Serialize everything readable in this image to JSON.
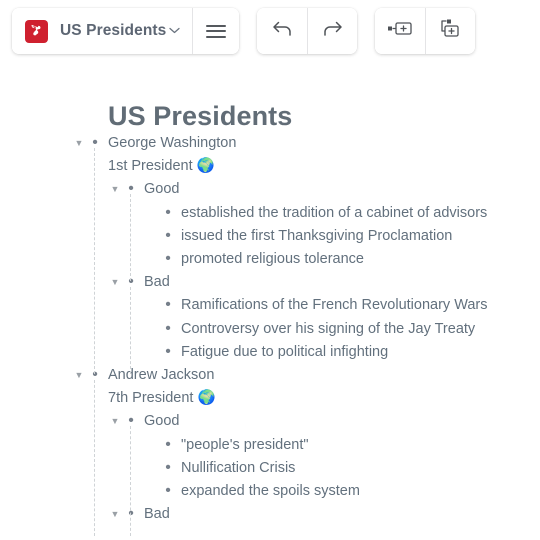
{
  "toolbar": {
    "logo_icon": "dynalist-logo-icon",
    "document_title": "US Presidents",
    "chevron": "⌄",
    "chevron_icon": "chevron-down-icon",
    "menu_icon": "hamburger-menu-icon",
    "undo_icon": "undo-arrow-icon",
    "redo_icon": "redo-arrow-icon",
    "insert_item_icon": "insert-item-icon",
    "insert_child_icon": "insert-child-item-icon"
  },
  "page": {
    "title": "US Presidents"
  },
  "outline": {
    "collapse_triangle": "▼",
    "bullet": "•",
    "rows": [
      {
        "depth": 0,
        "type": "item",
        "text": "George Washington",
        "has_triangle": true
      },
      {
        "depth": 0,
        "type": "note",
        "text": "1st President 🌍",
        "has_triangle": false
      },
      {
        "depth": 1,
        "type": "item",
        "text": "Good",
        "has_triangle": true
      },
      {
        "depth": 2,
        "type": "item",
        "text": "established the tradition of a cabinet of advisors",
        "has_triangle": false
      },
      {
        "depth": 2,
        "type": "item",
        "text": "issued the first Thanksgiving Proclamation",
        "has_triangle": false
      },
      {
        "depth": 2,
        "type": "item",
        "text": "promoted religious tolerance",
        "has_triangle": false
      },
      {
        "depth": 1,
        "type": "item",
        "text": "Bad",
        "has_triangle": true
      },
      {
        "depth": 2,
        "type": "item",
        "text": "Ramifications of the French Revolutionary Wars",
        "has_triangle": false
      },
      {
        "depth": 2,
        "type": "item",
        "text": "Controversy over his signing of the Jay Treaty",
        "has_triangle": false
      },
      {
        "depth": 2,
        "type": "item",
        "text": "Fatigue due to political infighting",
        "has_triangle": false
      },
      {
        "depth": 0,
        "type": "item",
        "text": "Andrew Jackson",
        "has_triangle": true
      },
      {
        "depth": 0,
        "type": "note",
        "text": "7th President 🌍",
        "has_triangle": false
      },
      {
        "depth": 1,
        "type": "item",
        "text": "Good",
        "has_triangle": true
      },
      {
        "depth": 2,
        "type": "item",
        "text": "\"people's president\"",
        "has_triangle": false
      },
      {
        "depth": 2,
        "type": "item",
        "text": "Nullification Crisis",
        "has_triangle": false
      },
      {
        "depth": 2,
        "type": "item",
        "text": "expanded the spoils system",
        "has_triangle": false
      },
      {
        "depth": 1,
        "type": "item",
        "text": "Bad",
        "has_triangle": true
      }
    ]
  },
  "colors": {
    "brand_red": "#cf202f",
    "text_gray": "#62707d",
    "title_gray": "#616c76",
    "guide_line": "#cfd3d6"
  }
}
